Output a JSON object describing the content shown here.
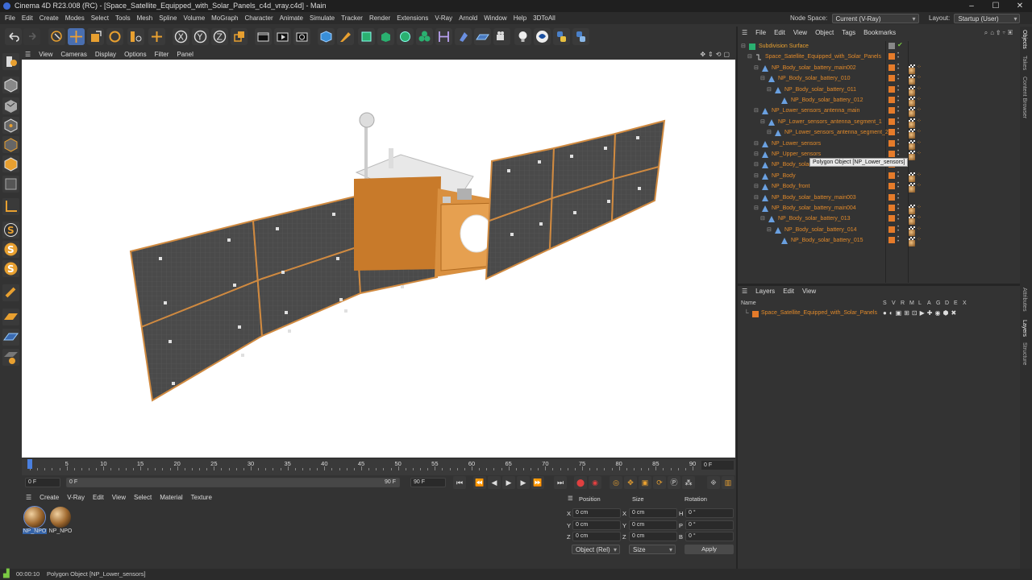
{
  "window": {
    "title": "Cinema 4D R23.008 (RC) - [Space_Satellite_Equipped_with_Solar_Panels_c4d_vray.c4d] - Main",
    "controls": [
      "–",
      "☐",
      "✕"
    ]
  },
  "menubar": {
    "items": [
      "File",
      "Edit",
      "Create",
      "Modes",
      "Select",
      "Tools",
      "Mesh",
      "Spline",
      "Volume",
      "MoGraph",
      "Character",
      "Animate",
      "Simulate",
      "Tracker",
      "Render",
      "Extensions",
      "V-Ray",
      "Arnold",
      "Window",
      "Help",
      "3DToAll"
    ],
    "node_space_label": "Node Space:",
    "node_space_value": "Current (V-Ray)",
    "layout_label": "Layout:",
    "layout_value": "Startup (User)"
  },
  "viewport": {
    "menu": [
      "View",
      "Cameras",
      "Display",
      "Options",
      "Filter",
      "Panel"
    ]
  },
  "timeline": {
    "ticks": [
      "0",
      "5",
      "10",
      "15",
      "20",
      "25",
      "30",
      "35",
      "40",
      "45",
      "50",
      "55",
      "60",
      "65",
      "70",
      "75",
      "80",
      "85",
      "90"
    ],
    "frame_display": "0 F",
    "start_field": "0 F",
    "range_start": "0 F",
    "range_end": "90 F",
    "end_field": "90 F"
  },
  "materials": {
    "menu": [
      "Create",
      "V-Ray",
      "Edit",
      "View",
      "Select",
      "Material",
      "Texture"
    ],
    "items": [
      {
        "label": "NP_NPO"
      },
      {
        "label": "NP_NPO"
      }
    ]
  },
  "coordinates": {
    "headers": {
      "position": "Position",
      "size": "Size",
      "rotation": "Rotation"
    },
    "rows": [
      {
        "axis": "X",
        "pos": "0 cm",
        "saxis": "X",
        "size": "0 cm",
        "raxis": "H",
        "rot": "0 °"
      },
      {
        "axis": "Y",
        "pos": "0 cm",
        "saxis": "Y",
        "size": "0 cm",
        "raxis": "P",
        "rot": "0 °"
      },
      {
        "axis": "Z",
        "pos": "0 cm",
        "saxis": "Z",
        "size": "0 cm",
        "raxis": "B",
        "rot": "0 °"
      }
    ],
    "mode_select": "Object (Rel)",
    "size_select": "Size",
    "apply_label": "Apply"
  },
  "objects": {
    "menu": [
      "File",
      "Edit",
      "View",
      "Object",
      "Tags",
      "Bookmarks"
    ],
    "rows": [
      {
        "name": "Subdivision Surface",
        "depth": 0,
        "tags": false
      },
      {
        "name": "Space_Satellite_Equipped_with_Solar_Panels",
        "depth": 1,
        "tags": false
      },
      {
        "name": "NP_Body_solar_battery_main002",
        "depth": 2,
        "tags": true
      },
      {
        "name": "NP_Body_solar_battery_010",
        "depth": 3,
        "tags": true
      },
      {
        "name": "NP_Body_solar_battery_011",
        "depth": 4,
        "tags": true
      },
      {
        "name": "NP_Body_solar_battery_012",
        "depth": 5,
        "tags": true
      },
      {
        "name": "NP_Lower_sensors_antenna_main",
        "depth": 2,
        "tags": true
      },
      {
        "name": "NP_Lower_sensors_antenna_segment_1",
        "depth": 3,
        "tags": true
      },
      {
        "name": "NP_Lower_sensors_antenna_segment_2",
        "depth": 4,
        "tags": true
      },
      {
        "name": "NP_Lower_sensors",
        "depth": 2,
        "tags": true
      },
      {
        "name": "NP_Upper_sensors",
        "depth": 2,
        "tags": true
      },
      {
        "name": "NP_Body_solar",
        "depth": 2,
        "tags": false
      },
      {
        "name": "NP_Body",
        "depth": 2,
        "tags": true
      },
      {
        "name": "NP_Body_front",
        "depth": 2,
        "tags": true
      },
      {
        "name": "NP_Body_solar_battery_main003",
        "depth": 2,
        "tags": false
      },
      {
        "name": "NP_Body_solar_battery_main004",
        "depth": 2,
        "tags": true
      },
      {
        "name": "NP_Body_solar_battery_013",
        "depth": 3,
        "tags": true
      },
      {
        "name": "NP_Body_solar_battery_014",
        "depth": 4,
        "tags": true
      },
      {
        "name": "NP_Body_solar_battery_015",
        "depth": 5,
        "tags": true
      }
    ],
    "tooltip": "Polygon Object [NP_Lower_sensors]"
  },
  "layers": {
    "menu": [
      "Layers",
      "Edit",
      "View"
    ],
    "name_header": "Name",
    "flags": [
      "S",
      "V",
      "R",
      "M",
      "L",
      "A",
      "G",
      "D",
      "E",
      "X"
    ],
    "rows": [
      {
        "name": "Space_Satellite_Equipped_with_Solar_Panels"
      }
    ]
  },
  "right_tabs": [
    "Objects",
    "Takes",
    "Content Browser",
    "Attributes",
    "Layers",
    "Structure"
  ],
  "status": {
    "time": "00:00:10",
    "message": "Polygon Object [NP_Lower_sensors]"
  },
  "colors": {
    "accent_orange": "#e57b2a",
    "selection_blue": "#4a80e0",
    "panel_bg": "#333333",
    "viewport_bg": "#ffffff"
  }
}
